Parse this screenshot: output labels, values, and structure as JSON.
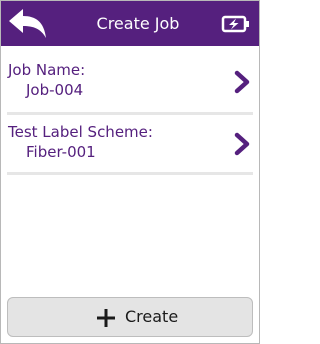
{
  "header": {
    "title": "Create Job",
    "back_icon": "back-arrow-icon",
    "battery_icon": "battery-charging-icon"
  },
  "fields": [
    {
      "label": "Job Name:",
      "value": "Job-004"
    },
    {
      "label": "Test Label Scheme:",
      "value": "Fiber-001"
    }
  ],
  "create_button": {
    "label": "Create",
    "icon": "plus-icon"
  },
  "colors": {
    "accent": "#55207e",
    "button_bg": "#e4e4e4"
  }
}
